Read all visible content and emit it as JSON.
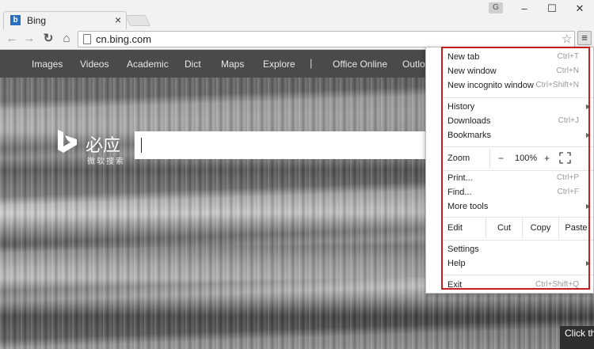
{
  "window": {
    "tab_title": "Bing",
    "tab_favicon": "b",
    "profile_badge": "G"
  },
  "toolbar": {
    "url": "cn.bing.com"
  },
  "bing": {
    "nav_items": [
      "Images",
      "Videos",
      "Academic",
      "Dict",
      "Maps",
      "Explore",
      "Office Online",
      "Outlook.com"
    ],
    "divider": "|",
    "logo_name": "必应",
    "logo_subtitle": "微软搜索",
    "hint_text": "Click th to rec"
  },
  "menu": {
    "group1": [
      {
        "label": "New tab",
        "shortcut": "Ctrl+T"
      },
      {
        "label": "New window",
        "shortcut": "Ctrl+N"
      },
      {
        "label": "New incognito window",
        "shortcut": "Ctrl+Shift+N"
      }
    ],
    "group2": [
      {
        "label": "History",
        "shortcut": "",
        "submenu": true
      },
      {
        "label": "Downloads",
        "shortcut": "Ctrl+J",
        "submenu": false
      },
      {
        "label": "Bookmarks",
        "shortcut": "",
        "submenu": true
      }
    ],
    "zoom": {
      "label": "Zoom",
      "minus": "−",
      "value": "100%",
      "plus": "+"
    },
    "group3": [
      {
        "label": "Print...",
        "shortcut": "Ctrl+P",
        "submenu": false
      },
      {
        "label": "Find...",
        "shortcut": "Ctrl+F",
        "submenu": false
      },
      {
        "label": "More tools",
        "shortcut": "",
        "submenu": true
      }
    ],
    "edit": {
      "label": "Edit",
      "cut": "Cut",
      "copy": "Copy",
      "paste": "Paste"
    },
    "group4": [
      {
        "label": "Settings",
        "shortcut": "",
        "submenu": false
      },
      {
        "label": "Help",
        "shortcut": "",
        "submenu": true
      }
    ],
    "exit": {
      "label": "Exit",
      "shortcut": "Ctrl+Shift+Q"
    }
  },
  "colors": {
    "highlight_border": "#c41e1e",
    "bing_nav_bg": "#4a4a4a"
  }
}
